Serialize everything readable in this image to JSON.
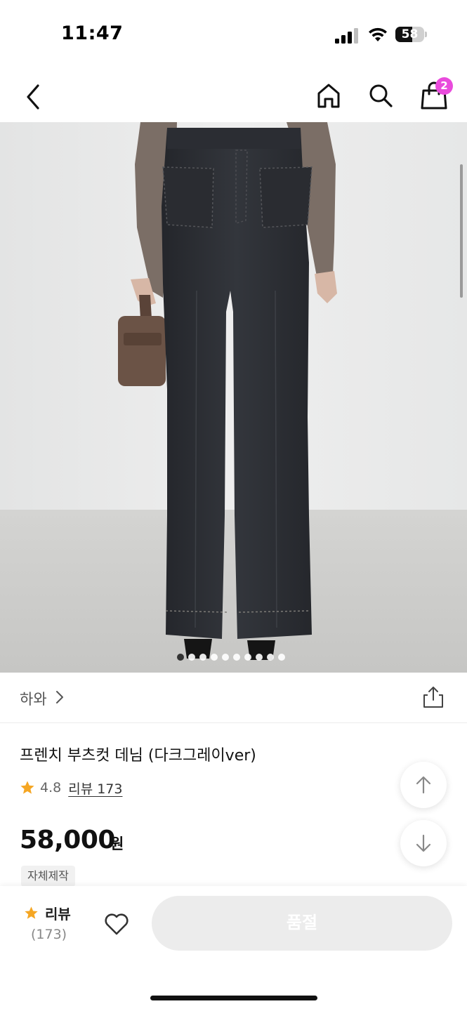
{
  "status_bar": {
    "time": "11:47",
    "battery": "58",
    "battery_level": 0.58
  },
  "nav": {
    "back_icon": "chevron-left-icon",
    "home_icon": "home-icon",
    "search_icon": "search-icon",
    "cart_icon": "shopping-bag-icon",
    "cart_badge": "2",
    "badge_color": "#e94bdc"
  },
  "gallery": {
    "image_count": 10,
    "current_index": 0
  },
  "brand": {
    "name": "하와",
    "chevron_icon": "chevron-right-icon",
    "share_icon": "share-icon"
  },
  "product": {
    "title": "프렌치 부츠컷 데님 (다크그레이ver)",
    "rating": "4.8",
    "review_link": "리뷰 173",
    "price": "58,000",
    "price_unit": "원",
    "tag": "자체제작",
    "star_color": "#f5a623"
  },
  "floating": {
    "up_icon": "arrow-up-icon",
    "down_icon": "arrow-down-icon"
  },
  "bottom_bar": {
    "review_label": "리뷰",
    "review_count": "(173)",
    "like_icon": "heart-icon",
    "soldout_label": "품절"
  }
}
